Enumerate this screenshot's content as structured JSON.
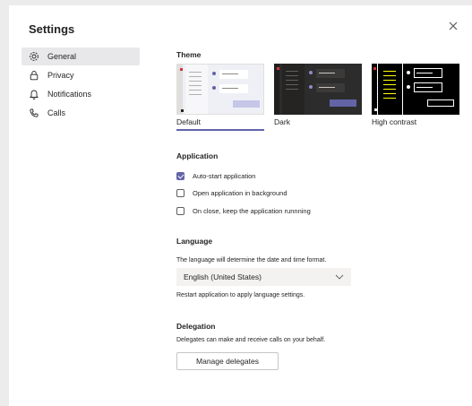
{
  "dialog": {
    "title": "Settings"
  },
  "nav": {
    "items": [
      {
        "label": "General",
        "icon": "gear-icon",
        "active": true
      },
      {
        "label": "Privacy",
        "icon": "lock-icon",
        "active": false
      },
      {
        "label": "Notifications",
        "icon": "bell-icon",
        "active": false
      },
      {
        "label": "Calls",
        "icon": "phone-icon",
        "active": false
      }
    ]
  },
  "theme": {
    "heading": "Theme",
    "options": [
      {
        "label": "Default",
        "selected": true
      },
      {
        "label": "Dark",
        "selected": false
      },
      {
        "label": "High contrast",
        "selected": false
      }
    ]
  },
  "application": {
    "heading": "Application",
    "options": [
      {
        "label": "Auto-start application",
        "checked": true
      },
      {
        "label": "Open application in background",
        "checked": false
      },
      {
        "label": "On close, keep the application runnning",
        "checked": false
      }
    ]
  },
  "language": {
    "heading": "Language",
    "description": "The language will determine the date and time format.",
    "selected": "English (United States)",
    "note": "Restart application to apply language settings."
  },
  "delegation": {
    "heading": "Delegation",
    "description": "Delegates can make and receive calls on your behalf.",
    "button_label": "Manage delegates"
  },
  "colors": {
    "accent": "#6264a7",
    "nav_active_bg": "#e8e8ea",
    "text": "#252423"
  }
}
